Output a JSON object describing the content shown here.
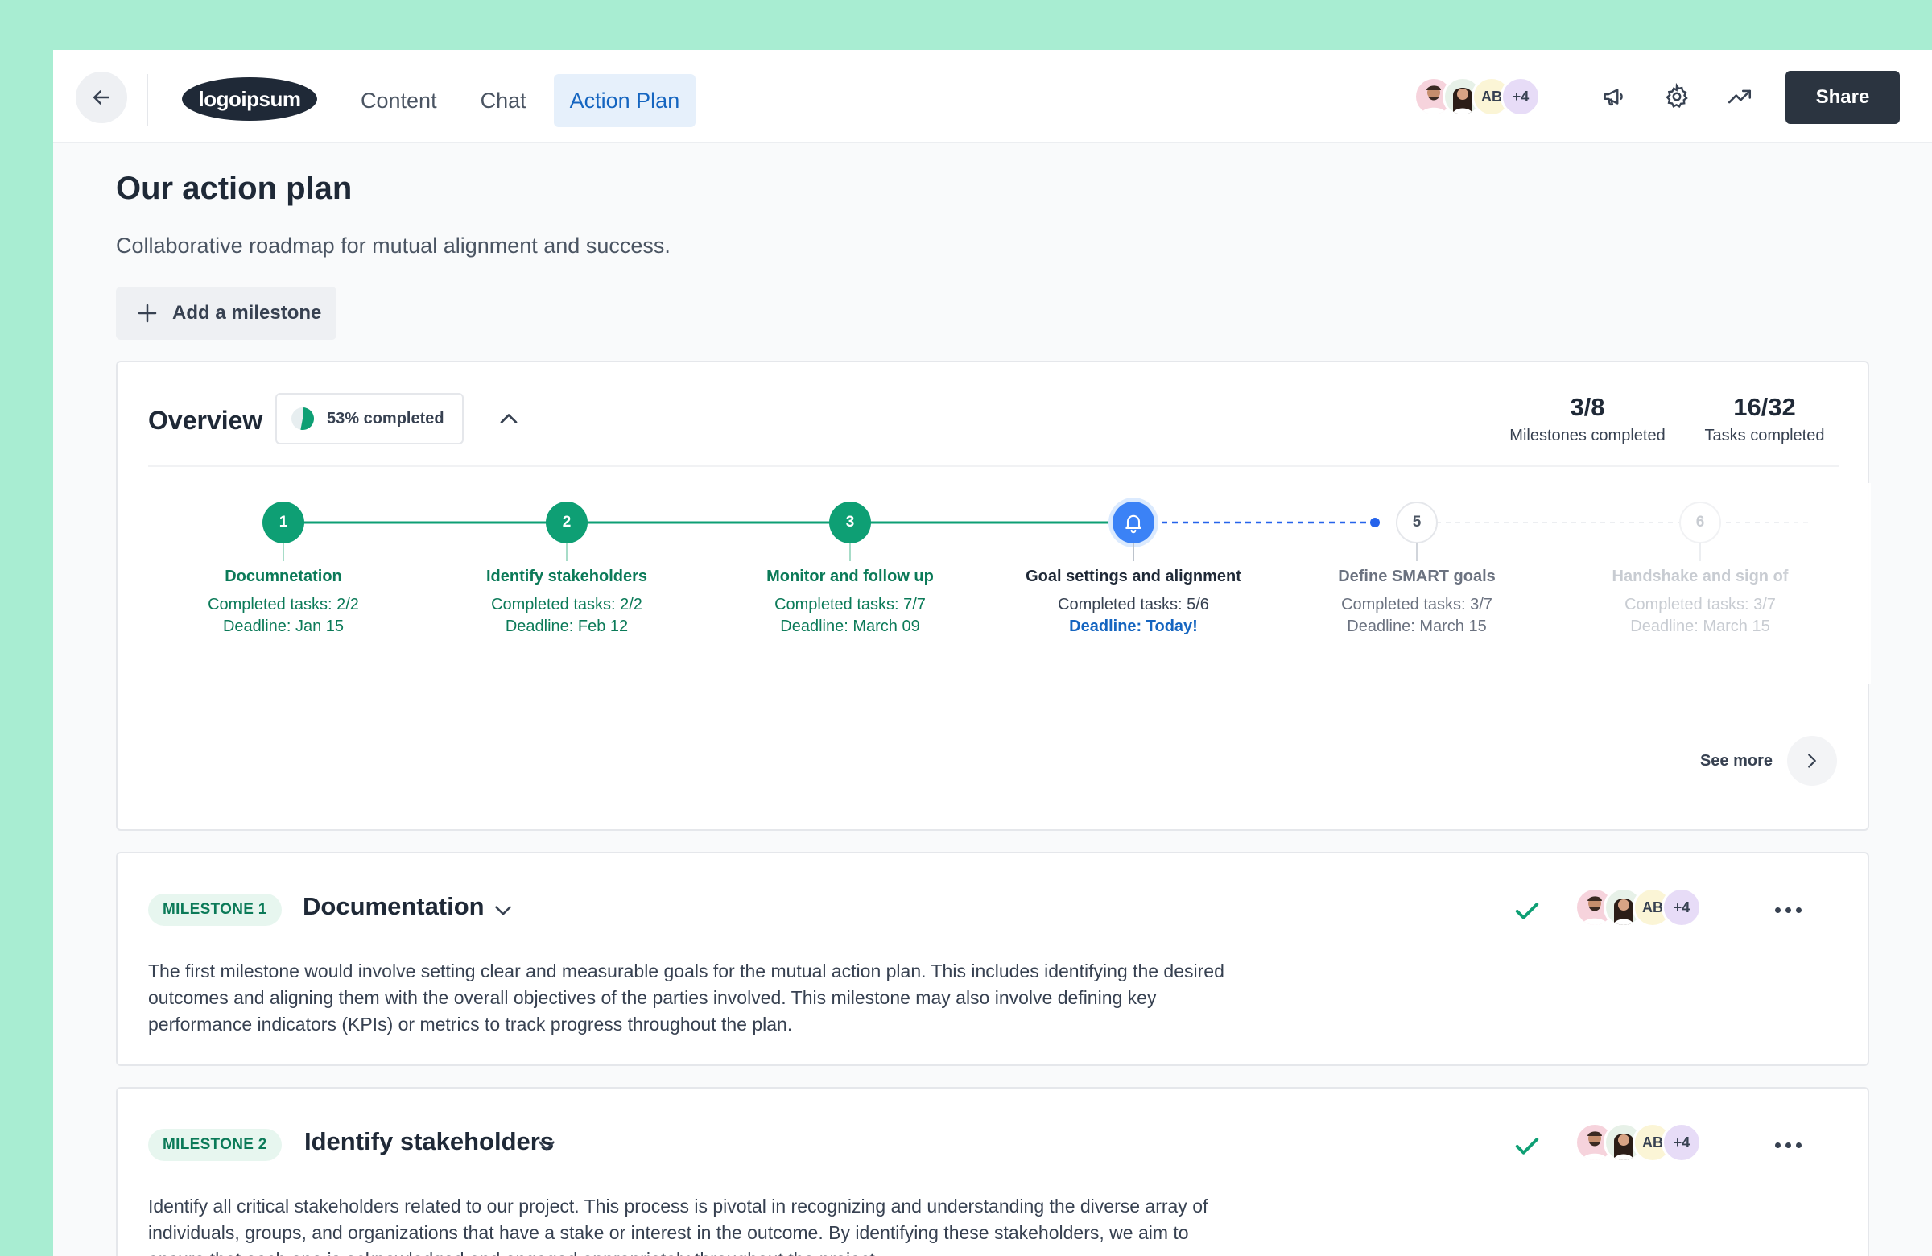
{
  "nav": {
    "logo": "logoipsum",
    "tabs": [
      "Content",
      "Chat",
      "Action Plan"
    ],
    "active_tab": "Action Plan",
    "avatars": {
      "initials": "AB",
      "more": "+4"
    },
    "share_label": "Share"
  },
  "page": {
    "title": "Our action plan",
    "subtitle": "Collaborative roadmap for mutual alignment and success.",
    "add_milestone_label": "Add a milestone"
  },
  "overview": {
    "title": "Overview",
    "progress_label": "53% completed",
    "progress_fraction": 0.53,
    "stats": [
      {
        "value": "3/8",
        "label": "Milestones completed"
      },
      {
        "value": "16/32",
        "label": "Tasks completed"
      }
    ],
    "milestones": [
      {
        "marker": "1",
        "name": "Documnetation",
        "tasks": "Completed tasks: 2/2",
        "deadline": "Deadline: Jan 15",
        "state": "done"
      },
      {
        "marker": "2",
        "name": "Identify stakeholders",
        "tasks": "Completed tasks: 2/2",
        "deadline": "Deadline: Feb 12",
        "state": "done"
      },
      {
        "marker": "3",
        "name": "Monitor and follow up",
        "tasks": "Completed tasks: 7/7",
        "deadline": "Deadline: March 09",
        "state": "done"
      },
      {
        "marker": "bell-icon",
        "name": "Goal settings and alignment",
        "tasks": "Completed tasks: 5/6",
        "deadline": "Deadline: Today!",
        "state": "current"
      },
      {
        "marker": "5",
        "name": "Define SMART goals",
        "tasks": "Completed tasks: 3/7",
        "deadline": "Deadline: March 15",
        "state": "next"
      },
      {
        "marker": "6",
        "name": "Handshake and sign of",
        "tasks": "Completed tasks: 3/7",
        "deadline": "Deadline: March 15",
        "state": "faded"
      }
    ],
    "see_more_label": "See more"
  },
  "milestone_cards": [
    {
      "badge": "MILESTONE 1",
      "title": "Documentation",
      "description": "The first milestone would involve setting clear and measurable goals for the mutual action plan. This includes identifying the desired outcomes and aligning them with the overall objectives of the parties involved. This milestone may also involve defining key performance indicators (KPIs) or metrics to track progress throughout the plan."
    },
    {
      "badge": "MILESTONE 2",
      "title": "Identify stakeholders",
      "description": "Identify all critical stakeholders related to our project. This process is pivotal in recognizing and understanding the diverse array of individuals, groups, and organizations that have a stake or interest in the outcome. By identifying these stakeholders, we aim to ensure that each one is acknowledged and engaged appropriately throughout the project."
    }
  ],
  "colors": {
    "background": "#a8edd2",
    "done_green": "#0e9f74",
    "current_blue": "#3b82f6",
    "accent_blue": "#1565c0",
    "share_button": "#2b3440"
  }
}
